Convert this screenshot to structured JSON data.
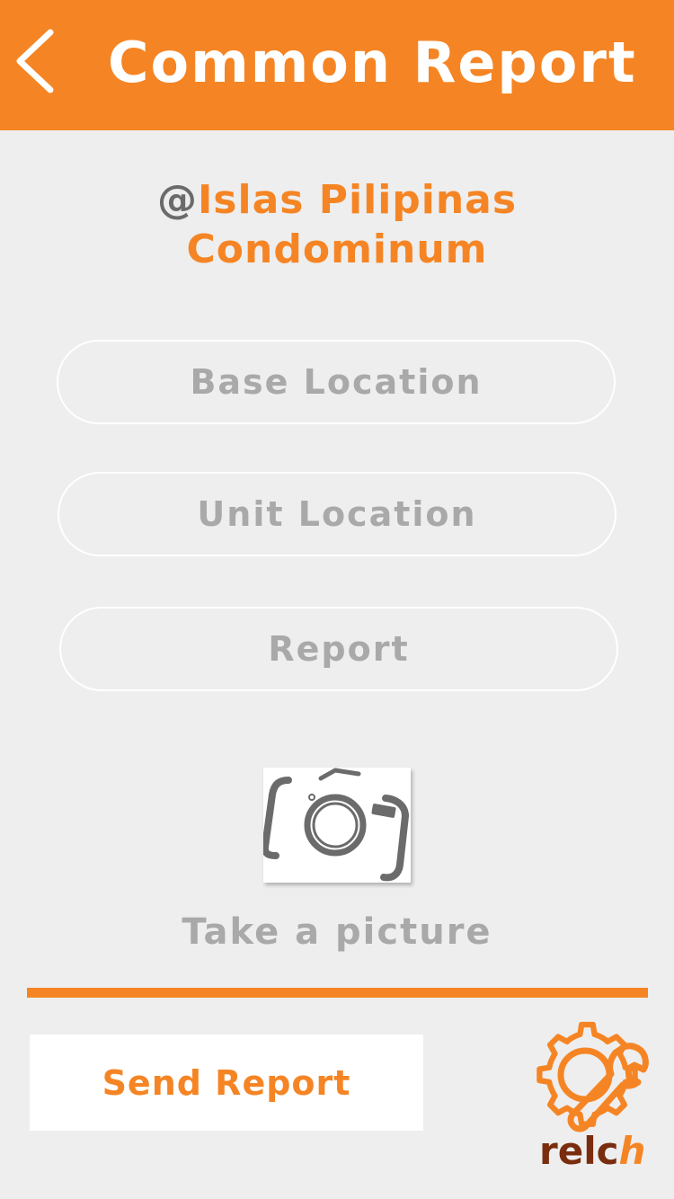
{
  "header": {
    "title": "Common Report",
    "back_icon": "chevron-left-icon"
  },
  "property": {
    "at_symbol": "@",
    "name_line1": "Islas Pilipinas",
    "name_line2": "Condominum"
  },
  "fields": {
    "base_location": "Base Location",
    "unit_location": "Unit Location",
    "report": "Report"
  },
  "camera": {
    "icon": "camera-icon",
    "label": "Take a picture"
  },
  "actions": {
    "send_report": "Send Report"
  },
  "logo": {
    "icon": "gear-wrench-icon",
    "word_part1": "relc",
    "word_part2": "h"
  },
  "colors": {
    "accent": "#f58524",
    "background": "#eeeeee",
    "muted_text": "#a9a9a9",
    "logo_brown": "#7a2d0e"
  }
}
